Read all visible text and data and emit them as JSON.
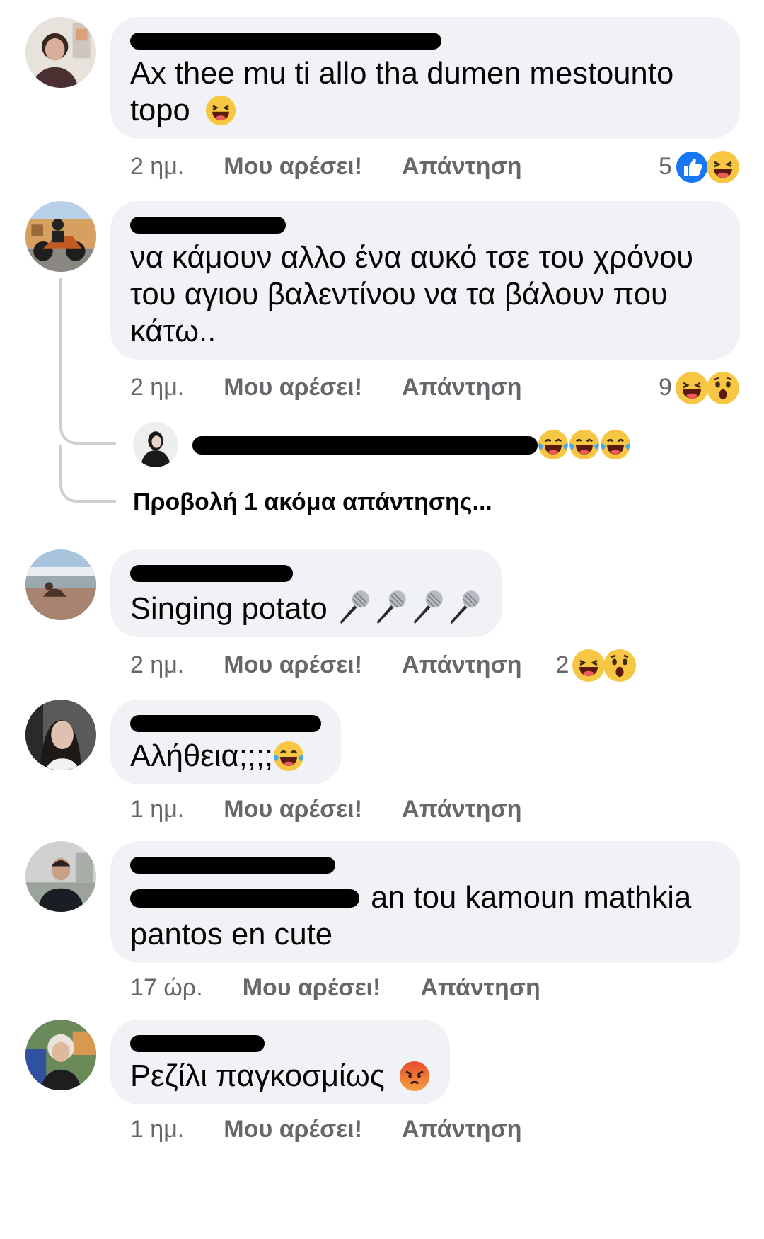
{
  "comments": [
    {
      "avatar": {
        "kind": "picture"
      },
      "author_redacted": true,
      "body": [
        {
          "kind": "text",
          "text": "Ax thee mu ti allo tha dumen mestounto"
        },
        {
          "kind": "text",
          "text": "topo"
        },
        {
          "kind": "haha"
        }
      ],
      "time": "2 ημ.",
      "like_label": "Μου αρέσει!",
      "reply_label": "Απάντηση",
      "reaction_count": "5",
      "reactions": [
        {
          "kind": "like"
        },
        {
          "kind": "haha"
        }
      ]
    },
    {
      "avatar": {
        "kind": "picture"
      },
      "author_redacted": true,
      "body": [
        {
          "kind": "text",
          "text": "να κάμουν αλλο ένα αυκό τσε του χρόνου του αγιου βαλεντίνου να τα βάλουν που κάτω.."
        }
      ],
      "time": "2 ημ.",
      "like_label": "Μου αρέσει!",
      "reply_label": "Απάντηση",
      "reaction_count": "9",
      "reactions": [
        {
          "kind": "haha"
        },
        {
          "kind": "wow"
        }
      ],
      "replies": [
        {
          "kind": "reply",
          "avatar": {
            "kind": "picture"
          },
          "author_redacted": true,
          "body": [
            {
              "kind": "tears-joy"
            },
            {
              "kind": "tears-joy"
            },
            {
              "kind": "tears-joy"
            }
          ]
        },
        {
          "kind": "more",
          "text": "Προβολή 1 ακόμα απάντησης..."
        }
      ]
    },
    {
      "avatar": {
        "kind": "picture"
      },
      "author_redacted": true,
      "body": [
        {
          "kind": "text",
          "text": "Singing potato"
        },
        {
          "kind": "microphone"
        },
        {
          "kind": "microphone"
        },
        {
          "kind": "microphone"
        },
        {
          "kind": "microphone"
        }
      ],
      "time": "2 ημ.",
      "like_label": "Μου αρέσει!",
      "reply_label": "Απάντηση",
      "reaction_count": "2",
      "reactions": [
        {
          "kind": "haha"
        },
        {
          "kind": "wow"
        }
      ]
    },
    {
      "avatar": {
        "kind": "picture"
      },
      "author_redacted": true,
      "body": [
        {
          "kind": "text",
          "text": "Αλήθεια;;;;"
        },
        {
          "kind": "tears-joy",
          "space_before": false
        }
      ],
      "time": "1 ημ.",
      "like_label": "Μου αρέσει!",
      "reply_label": "Απάντηση"
    },
    {
      "avatar": {
        "kind": "picture"
      },
      "author_redacted": true,
      "body": [
        {
          "kind": "redaction"
        },
        {
          "kind": "text",
          "text": "an tou kamoun mathkia"
        },
        {
          "kind": "text",
          "text": "pantos en cute"
        }
      ],
      "time": "17 ώρ.",
      "like_label": "Μου αρέσει!",
      "reply_label": "Απάντηση"
    },
    {
      "avatar": {
        "kind": "picture"
      },
      "author_redacted": true,
      "body": [
        {
          "kind": "text",
          "text": "Ρεζίλι παγκοσμίως"
        },
        {
          "kind": "angry"
        }
      ],
      "time": "1 ημ.",
      "like_label": "Μου αρέσει!",
      "reply_label": "Απάντηση"
    }
  ]
}
